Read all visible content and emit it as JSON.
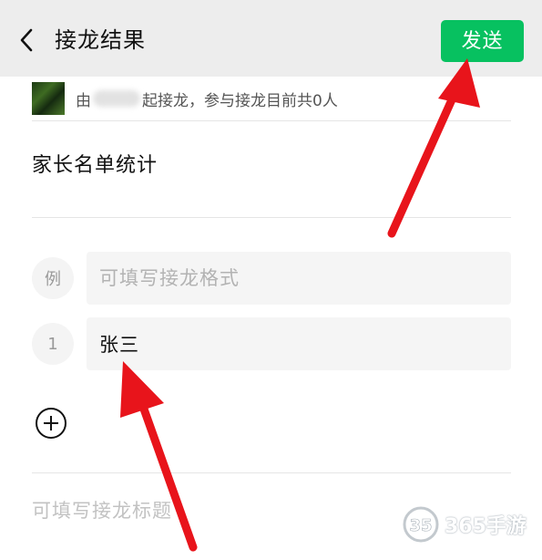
{
  "header": {
    "title": "接龙结果",
    "send_label": "发送",
    "back_icon": "chevron-left-icon"
  },
  "creator": {
    "prefix": "由",
    "suffix": "起接龙，参与接龙目前共0人"
  },
  "jielong": {
    "title": "家长名单统计"
  },
  "example": {
    "badge": "例",
    "placeholder": "可填写接龙格式"
  },
  "entries": [
    {
      "badge": "1",
      "value": "张三"
    }
  ],
  "add_icon": "plus-circle-icon",
  "footer": {
    "title_placeholder": "可填写接龙标题"
  },
  "watermark": {
    "text": "365手游",
    "logo_text": "35"
  },
  "colors": {
    "accent": "#07c160",
    "arrow": "#e8141b",
    "topbar": "#ededed"
  }
}
